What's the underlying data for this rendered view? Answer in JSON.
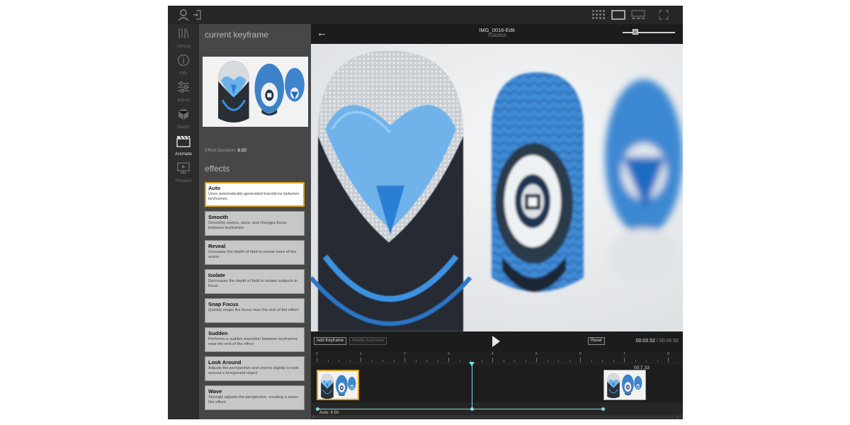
{
  "app": {
    "header": {
      "title": "IMG_0016-Edit",
      "date": "7/16/2015"
    },
    "nav": {
      "items": [
        {
          "label": "Library",
          "icon": "library-icon",
          "active": false
        },
        {
          "label": "Info",
          "icon": "info-icon",
          "active": false
        },
        {
          "label": "Adjust",
          "icon": "sliders-icon",
          "active": false
        },
        {
          "label": "Depth",
          "icon": "depth-icon",
          "active": false
        },
        {
          "label": "Animate",
          "icon": "clapperboard-icon",
          "active": true
        },
        {
          "label": "Present",
          "icon": "present-icon",
          "active": false
        }
      ]
    },
    "panel": {
      "current_keyframe_title": "current keyframe",
      "effect_duration_label": "Effect Duration:",
      "effect_duration_value": "6.50",
      "effects_title": "effects",
      "effects": [
        {
          "name": "Auto",
          "desc": "Uses automatically-generated transitions between keyframes",
          "selected": true
        },
        {
          "name": "Smooth",
          "desc": "Smoothly zooms, pans, and changes focus between keyframes",
          "selected": false
        },
        {
          "name": "Reveal",
          "desc": "Increases the depth of field to reveal more of the scene",
          "selected": false
        },
        {
          "name": "Isolate",
          "desc": "Decreases the depth of field to isolate subjects in focus",
          "selected": false
        },
        {
          "name": "Snap Focus",
          "desc": "Quickly snaps the focus near the end of the effect",
          "selected": false
        },
        {
          "name": "Sudden",
          "desc": "Performs a sudden transition between keyframes near the end of the effect",
          "selected": false
        },
        {
          "name": "Look Around",
          "desc": "Adjusts the perspective and zooms slightly to look around a foreground object",
          "selected": false
        },
        {
          "name": "Wave",
          "desc": "Strongly adjusts the perspective, creating a wave-like effect",
          "selected": false
        }
      ]
    },
    "controls": {
      "add_keyframe": "Add Keyframe",
      "modify_keyframe": "Modify Keyframe",
      "reset": "Reset",
      "current_time": "00:03.52",
      "total_time": " / 00:06.50"
    },
    "timeline": {
      "ticks": [
        "0",
        "1",
        "2",
        "3",
        "4",
        "5",
        "6",
        "7",
        "8"
      ],
      "keyframe_time": "00:7.33",
      "segment_label": "Auto: 6.50"
    },
    "colors": {
      "accent": "#e0a21f",
      "playhead": "#7fe1ee",
      "owl_blue": "#3f8fd6"
    }
  }
}
